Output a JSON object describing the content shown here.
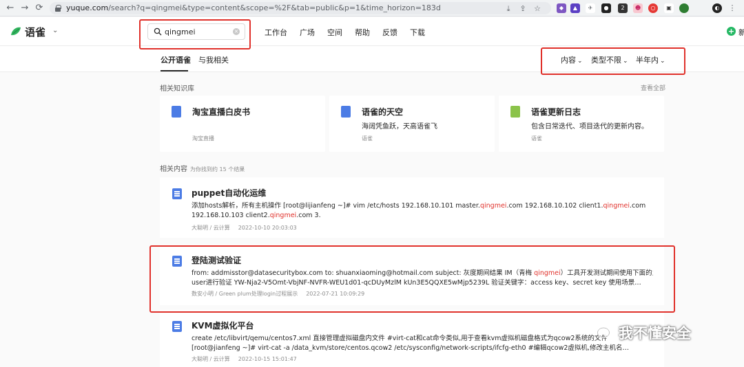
{
  "browser": {
    "back": "←",
    "forward": "→",
    "reload": "⟳",
    "url_host": "yuque.com",
    "url_path": "/search?q=qingmei&type=content&scope=%2F&tab=public&p=1&time_horizon=183d",
    "badge_count": "2"
  },
  "header": {
    "logo": "语雀",
    "search_value": "qingmei",
    "nav": [
      "工作台",
      "广场",
      "空间",
      "帮助",
      "反馈",
      "下载"
    ]
  },
  "tabs": {
    "public": "公开语雀",
    "related_to_me": "与我相关"
  },
  "filters": {
    "content": "内容",
    "type": "类型不限",
    "time": "半年内"
  },
  "kb_section": {
    "label": "相关知识库",
    "view_all": "查看全部",
    "cards": [
      {
        "title": "淘宝直播白皮书",
        "desc": "",
        "owner": "淘宝直播",
        "color": "#4c7ce5"
      },
      {
        "title": "语雀的天空",
        "desc": "海阔凭鱼跃，天高语雀飞",
        "owner": "语雀",
        "color": "#4c7ce5"
      },
      {
        "title": "语雀更新日志",
        "desc": "包含日常迭代、项目迭代的更新内容。",
        "owner": "语雀",
        "color": "#8bc34a"
      }
    ]
  },
  "results_section": {
    "label": "相关内容",
    "sub": "为你找到约 15 个结果"
  },
  "results": [
    {
      "title": "puppet自动化运维",
      "line1_a": "添加hosts解析，所有主机操作 [root@lijianfeng ~]# vim /etc/hosts 192.168.10.101 master.",
      "line1_hl": "qingmei",
      "line1_b": ".com 192.168.10.102 client1.",
      "line1_hl2": "qingmei",
      "line1_c": ".com",
      "line2_a": "192.168.10.103 client2.",
      "line2_hl": "qingmei",
      "line2_b": ".com 3.",
      "author": "大聪明 / 云计算",
      "date": "2022-10-10 20:03:03"
    },
    {
      "title": "登陆测试验证",
      "line1_a": "from: addmisstor@datasecuritybox.com to: shuanxiaoming@hotmail.com subject: 灰度期间结果 IM（青梅 ",
      "line1_hl": "qingmei",
      "line1_b": "）工具开发测试期间使用下面的主",
      "line2_a": "user进行验证 YW-Nja2-V5Omt-VbjNF-NVFR-WEU1d01-qcDUyMzlM kUn3E5QQXE5wMjp5239L 验证关键字：access key、secret key 使用场景…",
      "author": "数安小明 / Green plum处理login过程展示",
      "date": "2022-07-21 10:09:29"
    },
    {
      "title": "KVM虚拟化平台",
      "line1_a": "create /etc/libvirt/qemu/centos7.xml 直接管理虚拟磁盘内文件 #virt-cat和cat命令类似,用于查看kvm虚拟机磁盘格式为qcow2系统的文件",
      "line2_a": "[root@jianfeng ~]# virt-cat -a /data_kvm/store/centos.qcow2 /etc/sysconfig/network-scripts/ifcfg-eth0 #编辑qcow2虚拟机,修改主机名…",
      "author": "大聪明 / 云计算",
      "date": "2022-10-15 15:01:47"
    }
  ],
  "watermark": "我不懂安全"
}
